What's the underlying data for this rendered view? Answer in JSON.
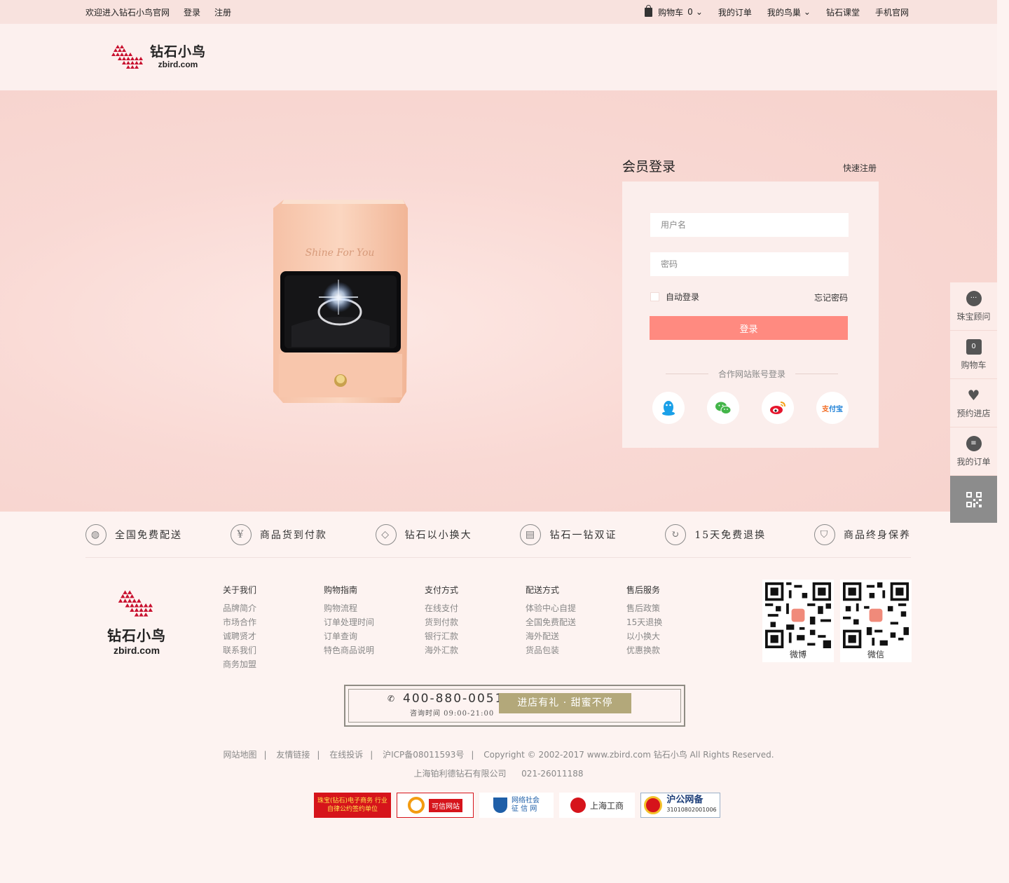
{
  "topbar": {
    "welcome": "欢迎进入钻石小鸟官网",
    "login": "登录",
    "register": "注册",
    "cart_label": "购物车",
    "cart_count": "0",
    "my_orders": "我的订单",
    "my_nest": "我的鸟巢",
    "diamond_class": "钻石课堂",
    "mobile_site": "手机官网"
  },
  "logo": {
    "cn": "钻石小鸟",
    "en": "zbird.com"
  },
  "hero": {
    "box_text": "Shine For You"
  },
  "login": {
    "title": "会员登录",
    "quick_register": "快速注册",
    "username_placeholder": "用户名",
    "password_placeholder": "密码",
    "auto_login": "自动登录",
    "forgot": "忘记密码",
    "submit": "登录",
    "partner_title": "合作网站账号登录",
    "partners": [
      "QQ",
      "微信",
      "微博",
      "支付宝"
    ]
  },
  "sidebar": {
    "advisor": "珠宝顾问",
    "cart": "购物车",
    "cart_count": "0",
    "reserve": "预约进店",
    "orders": "我的订单"
  },
  "services": [
    {
      "label": "全国免费配送",
      "icon": "globe-icon"
    },
    {
      "label": "商品货到付款",
      "icon": "payment-icon"
    },
    {
      "label": "钻石以小换大",
      "icon": "diamond-icon"
    },
    {
      "label": "钻石一钻双证",
      "icon": "certificate-icon"
    },
    {
      "label": "15天免费退换",
      "icon": "refresh-icon"
    },
    {
      "label": "商品终身保养",
      "icon": "shield-icon"
    }
  ],
  "footer": {
    "cols": [
      {
        "title": "关于我们",
        "items": [
          "品牌简介",
          "市场合作",
          "诚聘贤才",
          "联系我们",
          "商务加盟"
        ]
      },
      {
        "title": "购物指南",
        "items": [
          "购物流程",
          "订单处理时间",
          "订单查询",
          "特色商品说明"
        ]
      },
      {
        "title": "支付方式",
        "items": [
          "在线支付",
          "货到付款",
          "银行汇款",
          "海外汇款"
        ]
      },
      {
        "title": "配送方式",
        "items": [
          "体验中心自提",
          "全国免费配送",
          "海外配送",
          "货品包装"
        ]
      },
      {
        "title": "售后服务",
        "items": [
          "售后政策",
          "15天退换",
          "以小换大",
          "优惠换款"
        ]
      }
    ],
    "qr_weibo": "微博",
    "qr_weixin": "微信",
    "hotline": "400-880-0051",
    "hotline_time": "咨询时间 09:00-21:00",
    "slogan": "进店有礼 · 甜蜜不停",
    "links": [
      "网站地图",
      "友情链接",
      "在线投诉",
      "沪ICP备08011593号",
      "Copyright © 2002-2017 www.zbird.com  钻石小鸟  All Rights Reserved."
    ],
    "company": "上海铂利德钻石有限公司",
    "company_phone": "021-26011188",
    "badges": {
      "b1": "珠宝(钻石)电子商务 行业自律公约签约单位",
      "b2": "可信网站",
      "b3_a": "网络社会",
      "b3_b": "征 信 网",
      "b4": "上海工商",
      "b5_a": "沪公网备",
      "b5_b": "31010802001006"
    }
  },
  "colors": {
    "accent": "#ff8a80",
    "topbar": "#f8e2de",
    "hero": "#f9d9d4"
  }
}
